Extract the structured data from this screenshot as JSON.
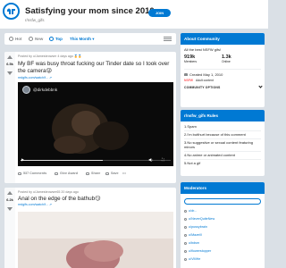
{
  "header": {
    "title": "Satisfying your mom since 2010",
    "subreddit": "r/nsfw_gifs",
    "join_label": "JOIN"
  },
  "sortbar": {
    "hot": "Hot",
    "new": "New",
    "top": "Top",
    "this_month": "This Month ▾",
    "view_icon": "card-view-icon"
  },
  "posts": [
    {
      "votes": "6.5k",
      "meta": "Posted by u/Jamesbrowser 4 days ago  🏅🏅",
      "title": "My BF was busy throat fucking our Tinder date so I took over the camera😜",
      "link": "redgifs.com/watch/f... ↗",
      "video": {
        "channel": "@dirkdebbnk",
        "progress": 0.55
      },
      "actions": {
        "comments": "537 Comments",
        "award": "Give Award",
        "share": "Share",
        "save": "Save",
        "more": "•••"
      }
    },
    {
      "votes": "6.2k",
      "meta": "Posted by u/Jamesbrowser65 20 days ago",
      "title": "Anal on the edge of the bathub😏",
      "link": "redgifs.com/watch/f... ↗"
    }
  ],
  "about": {
    "heading": "About Community",
    "description": "All the best NSFW gifs!",
    "members_count": "919k",
    "members_label": "Members",
    "online_count": "1.3k",
    "online_label": "Online",
    "created": "Created May 1, 2010",
    "tag_nsfw": "NSFW",
    "tag_adult": "Adult content",
    "options": "COMMUNITY OPTIONS"
  },
  "rules": {
    "heading": "r/nsfw_gifs Rules",
    "items": [
      "1.Spam",
      "2.I'm butthurt because of this comment",
      "3.No suggestive or sexual content featuring minors",
      "4.No anime or animated content",
      "5.Not a gif"
    ]
  },
  "mods": {
    "heading": "Moderators",
    "items": [
      "u/dr...",
      "u/NeverQuiteNew",
      "u/pussybrain",
      "u/Mazeill",
      "u/bdsm",
      "u/flowerstopper",
      "u/VMHe"
    ]
  },
  "colors": {
    "accent": "#0079d3",
    "nsfw": "#ff585b"
  }
}
